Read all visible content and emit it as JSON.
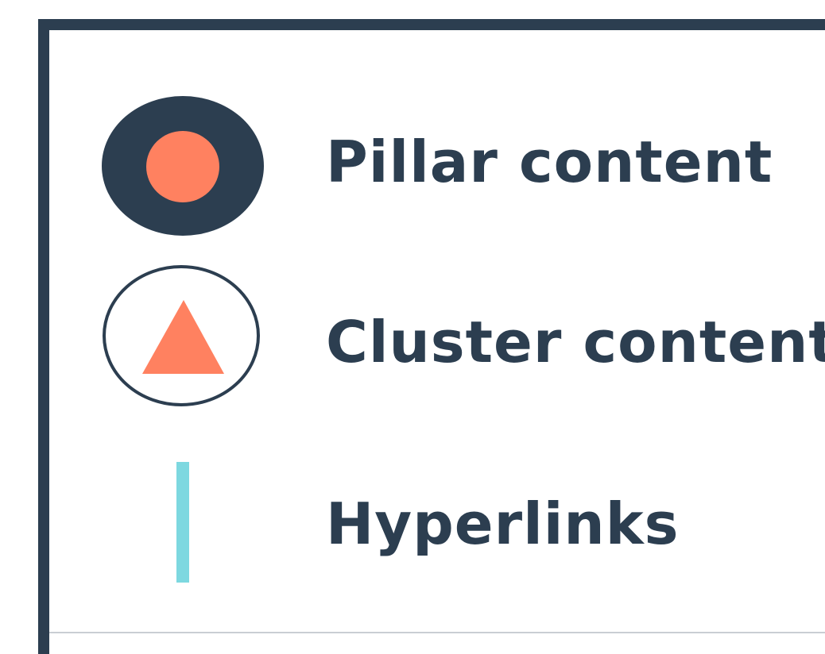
{
  "legend": {
    "items": [
      {
        "label": "Pillar content",
        "symbol": "pillar-icon"
      },
      {
        "label": "Cluster content",
        "symbol": "cluster-icon"
      },
      {
        "label": "Hyperlinks",
        "symbol": "hyperlink-line-icon"
      }
    ]
  },
  "colors": {
    "navy": "#2c3e50",
    "coral": "#ff8160",
    "teal": "#7dd8e0"
  }
}
